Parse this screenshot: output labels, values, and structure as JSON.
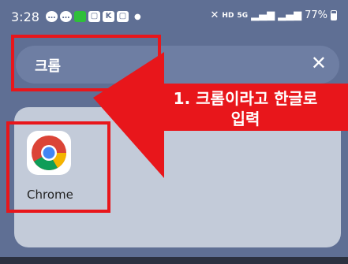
{
  "status_bar": {
    "time": "3:28",
    "battery": "77%",
    "network_hd": "HD",
    "network_5g": "5G",
    "left_icons": [
      "message-icon",
      "message-icon",
      "app-icon-green",
      "app-icon-chat",
      "app-icon-k",
      "app-icon-chat",
      "dot-icon"
    ],
    "right_icons": [
      "mute-icon",
      "signal-icon",
      "signal-icon",
      "battery-icon"
    ]
  },
  "search": {
    "query": "크롬",
    "clear_icon": "close-icon"
  },
  "results": {
    "apps": [
      {
        "label": "Chrome",
        "icon": "chrome-icon"
      }
    ]
  },
  "annotation": {
    "text_line1": "1. 크롬이라고 한글로",
    "text_line2": "입력",
    "color": "#e8161b"
  },
  "colors": {
    "background": "#5f6f94",
    "search_bar": "#6e7ea3",
    "panel": "#c3cbd9",
    "annotation_red": "#e8161b"
  }
}
